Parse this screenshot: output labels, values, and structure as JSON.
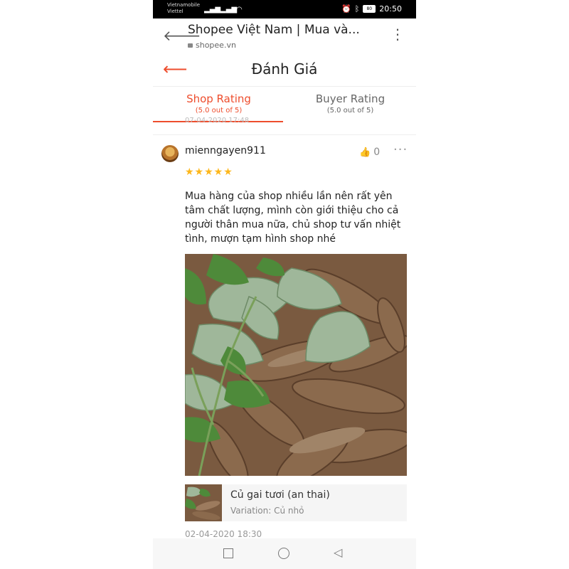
{
  "status_bar": {
    "carrier_line1": "Vietnamobile",
    "carrier_line2": "Viettel",
    "battery": "80",
    "time": "20:50"
  },
  "browser": {
    "back_icon": "arrow-left-icon",
    "title": "Shopee Việt Nam | Mua và...",
    "url": "shopee.vn",
    "menu_icon": "kebab-menu-icon"
  },
  "header": {
    "title": "Đánh Giá"
  },
  "tabs": [
    {
      "label": "Shop Rating",
      "sub": "(5.0 out of 5)",
      "active": true
    },
    {
      "label": "Buyer Rating",
      "sub": "(5.0 out of 5)",
      "active": false
    }
  ],
  "previous_review_date": "07-04-2020 17:48",
  "review": {
    "username": "mienngayen911",
    "likes": "0",
    "stars": "★★★★★",
    "rating": 5,
    "text": "Mua hàng của shop nhiều lần nên rất yên tâm chất lượng, mình còn giới thiệu cho cả người thân mua nữa, chủ shop tư vấn nhiệt tình, mượn tạm hình shop nhé",
    "date": "02-04-2020 18:30"
  },
  "product": {
    "name": "Củ gai tươi (an thai)",
    "variation": "Variation: Củ nhỏ"
  },
  "colors": {
    "accent": "#ee4d2d",
    "star": "#fdb71c"
  }
}
